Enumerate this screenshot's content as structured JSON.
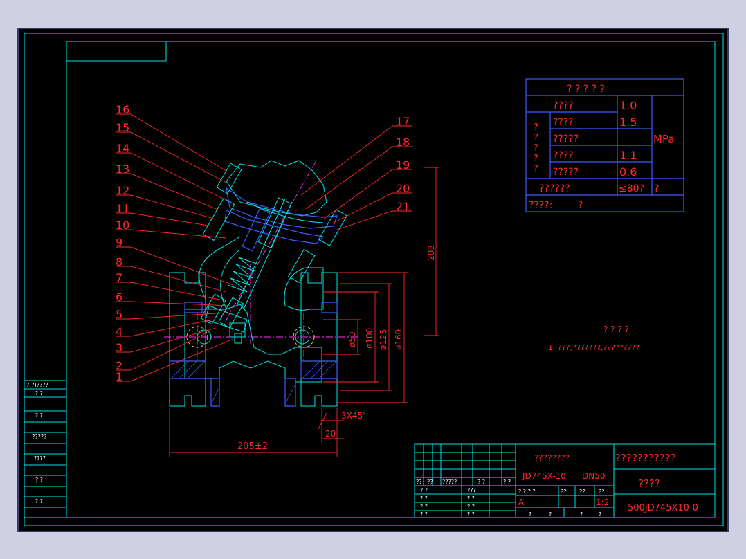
{
  "drawing": {
    "part_numbers": [
      "16",
      "15",
      "14",
      "13",
      "12",
      "11",
      "10",
      "9",
      "8",
      "7",
      "6",
      "5",
      "4",
      "3",
      "2",
      "1",
      "17",
      "18",
      "19",
      "20",
      "21"
    ],
    "dimensions": {
      "dim_203": "203",
      "dim_50": "ø50",
      "dim_100": "ø100",
      "dim_125": "ø125",
      "dim_160": "ø160",
      "dim_chamfer": "3X45'",
      "dim_20": "20",
      "dim_205": "205±2"
    }
  },
  "spec_table": {
    "title": "? ? ? ? ?",
    "rows": [
      {
        "label": "????",
        "value": "1.0"
      },
      {
        "label": "????",
        "value": "1.5"
      },
      {
        "label": "?????",
        "value": ""
      },
      {
        "label": "????",
        "value": "1.1"
      },
      {
        "label": "?????",
        "value": "0.6"
      }
    ],
    "side_label": [
      "?",
      "?",
      "?",
      "?",
      "?"
    ],
    "unit": "MPa",
    "temp_label": "??????",
    "temp_value": "≤80?",
    "temp_unit": "?",
    "medium_label": "????:",
    "medium_value": "?"
  },
  "notes": {
    "title": "? ? ? ?",
    "line1": "1. ???,???????,?????????"
  },
  "left_strip": {
    "header": "?(?)????",
    "rows": [
      "?  ?",
      "?  ?",
      "?????",
      "????",
      "?  ?",
      "?  ?"
    ]
  },
  "title_block": {
    "product_name": "????????",
    "model": "JD745X-10",
    "size": "DN50",
    "company": "???????????",
    "drawing_name": "????",
    "drawing_number": "500JD745X10-0",
    "scale": "1:2",
    "stage": "A",
    "header_row": [
      "??",
      "??",
      "?????",
      "?  ?",
      "?  ?"
    ],
    "sign_rows": [
      [
        "? ?",
        "???"
      ],
      [
        "? ?",
        "? ?"
      ],
      [
        "? ?",
        "? ?"
      ],
      [
        "? ?",
        "? ?"
      ]
    ],
    "scale_headers": [
      "?  ?  ?  ?",
      "??",
      "??",
      "??"
    ],
    "bottom_row": [
      "?",
      "?",
      "?",
      "?"
    ]
  }
}
